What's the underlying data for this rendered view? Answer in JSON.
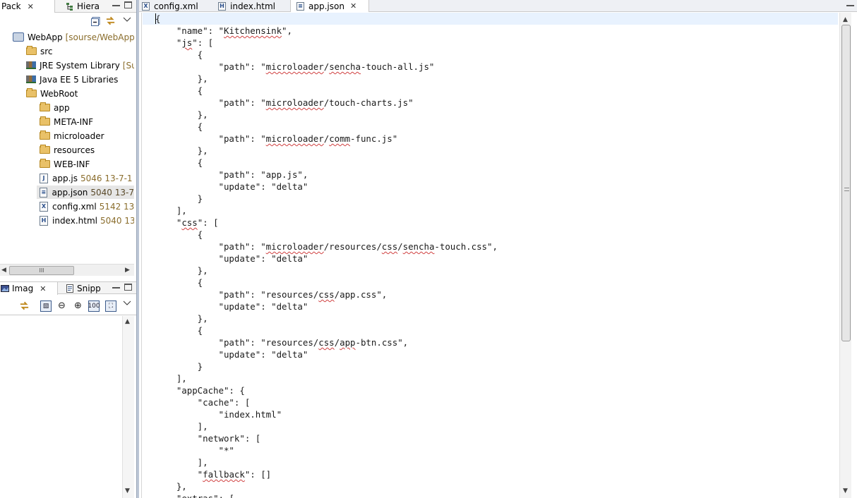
{
  "package_view": {
    "tabs": [
      {
        "label": "Pack",
        "icon": "package-explorer-icon",
        "active": true
      },
      {
        "label": "Hiera",
        "icon": "hierarchy-icon",
        "active": false
      }
    ],
    "close_glyph": "✕",
    "tree": [
      {
        "label": "WebApp",
        "decoration": "[sourse/WebApp",
        "type": "project",
        "depth": 0
      },
      {
        "label": "src",
        "decoration": "",
        "type": "source-folder",
        "depth": 1
      },
      {
        "label": "JRE System Library",
        "decoration": "[Su",
        "type": "library",
        "depth": 1
      },
      {
        "label": "Java EE 5 Libraries",
        "decoration": "",
        "type": "library",
        "depth": 1
      },
      {
        "label": "WebRoot",
        "decoration": "",
        "type": "folder",
        "depth": 1
      },
      {
        "label": "app",
        "decoration": "",
        "type": "folder",
        "depth": 2
      },
      {
        "label": "META-INF",
        "decoration": "",
        "type": "folder",
        "depth": 2
      },
      {
        "label": "microloader",
        "decoration": "",
        "type": "folder",
        "depth": 2
      },
      {
        "label": "resources",
        "decoration": "",
        "type": "folder",
        "depth": 2
      },
      {
        "label": "WEB-INF",
        "decoration": "",
        "type": "folder",
        "depth": 2
      },
      {
        "label": "app.js",
        "decoration": "5046  13-7-1",
        "type": "file-js",
        "depth": 2
      },
      {
        "label": "app.json",
        "decoration": "5040  13-7",
        "type": "file-json",
        "depth": 2,
        "selected": true
      },
      {
        "label": "config.xml",
        "decoration": "5142  13",
        "type": "file-xml",
        "depth": 2
      },
      {
        "label": "index.html",
        "decoration": "5040  13",
        "type": "file-html",
        "depth": 2
      }
    ],
    "hscroll_grip": "III"
  },
  "image_view": {
    "tabs": [
      {
        "label": "Imag",
        "icon": "image-view-icon",
        "active": true
      },
      {
        "label": "Snipp",
        "icon": "snippets-icon",
        "active": false
      }
    ]
  },
  "editor": {
    "tabs": [
      {
        "label": "config.xml",
        "icon_letter": "X",
        "active": false
      },
      {
        "label": "index.html",
        "icon_letter": "H",
        "active": false
      },
      {
        "label": "app.json",
        "icon_letter": "",
        "active": true
      }
    ],
    "lines": [
      "{",
      "    \"name\": \"Kitchensink\",",
      "    \"js\": [",
      "        {",
      "            \"path\": \"microloader/sencha-touch-all.js\"",
      "        },",
      "        {",
      "            \"path\": \"microloader/touch-charts.js\"",
      "        },",
      "        {",
      "            \"path\": \"microloader/comm-func.js\"",
      "        },",
      "        {",
      "            \"path\": \"app.js\",",
      "            \"update\": \"delta\"",
      "        }",
      "    ],",
      "    \"css\": [",
      "        {",
      "            \"path\": \"microloader/resources/css/sencha-touch.css\",",
      "            \"update\": \"delta\"",
      "        },",
      "        {",
      "            \"path\": \"resources/css/app.css\",",
      "            \"update\": \"delta\"",
      "        },",
      "        {",
      "            \"path\": \"resources/css/app-btn.css\",",
      "            \"update\": \"delta\"",
      "        }",
      "    ],",
      "    \"appCache\": {",
      "        \"cache\": [",
      "            \"index.html\"",
      "        ],",
      "        \"network\": [",
      "            \"*\"",
      "        ],",
      "        \"fallback\": []",
      "    },",
      "    \"extras\": ["
    ]
  }
}
